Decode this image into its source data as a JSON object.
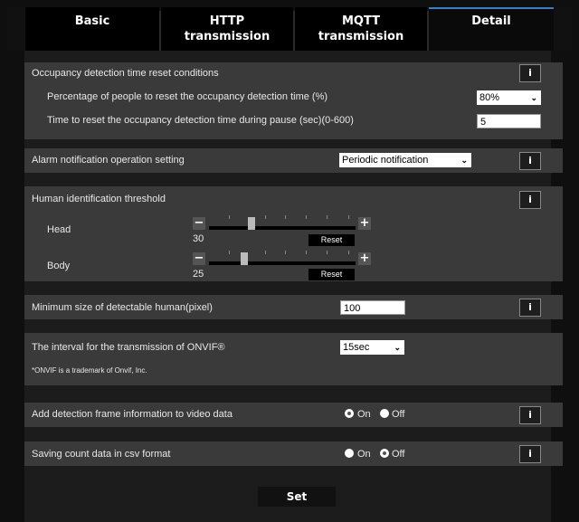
{
  "tabs": [
    {
      "line1": "Basic",
      "line2": ""
    },
    {
      "line1": "HTTP",
      "line2": "transmission"
    },
    {
      "line1": "MQTT",
      "line2": "transmission"
    },
    {
      "line1": "Detail",
      "line2": ""
    }
  ],
  "active_tab": "Detail",
  "info_label": "i",
  "occupancy": {
    "title": "Occupancy detection time reset conditions",
    "percentage_label": "Percentage of people to reset the occupancy detection time (%)",
    "percentage_value": "80%",
    "time_label": "Time to reset the occupancy detection time during pause (sec)(0-600)",
    "time_value": "5"
  },
  "alarm": {
    "label": "Alarm notification operation setting",
    "value": "Periodic notification"
  },
  "threshold": {
    "title": "Human identification threshold",
    "head_label": "Head",
    "head_value": "30",
    "body_label": "Body",
    "body_value": "25",
    "reset_label": "Reset",
    "minus": "−",
    "plus": "+"
  },
  "min_size": {
    "label": "Minimum size of detectable human(pixel)",
    "value": "100"
  },
  "onvif": {
    "label": "The interval for the transmission of ONVIF®",
    "value": "15sec",
    "note": "*ONVIF is a trademark of Onvif, Inc."
  },
  "frame_info": {
    "label": "Add detection frame information to video data",
    "on_label": "On",
    "off_label": "Off",
    "selected": "On"
  },
  "csv": {
    "label": "Saving count data in csv format",
    "on_label": "On",
    "off_label": "Off",
    "selected": "Off"
  },
  "set_label": "Set",
  "colors": {
    "active_tab_accent": "#3a7fc4",
    "section_bg": "#3a3a3a",
    "panel_bg": "#1c1c1c"
  }
}
